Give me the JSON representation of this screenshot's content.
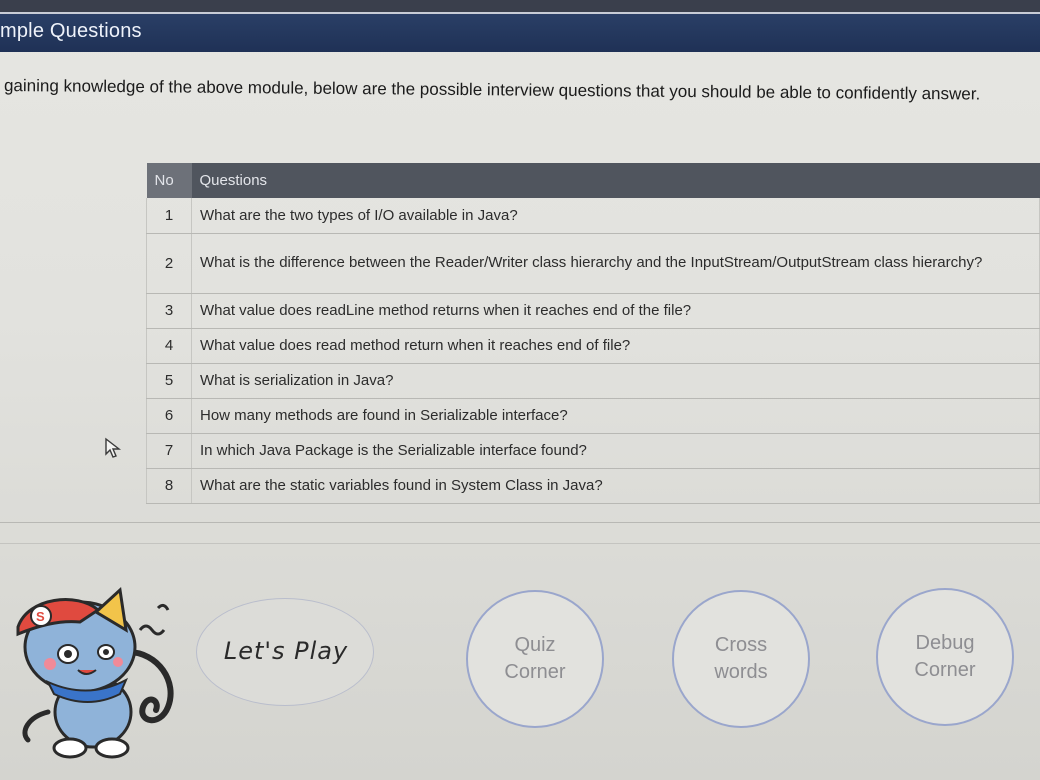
{
  "header": {
    "title": "mple Questions"
  },
  "intro": "gaining knowledge of the above module, below are the possible interview questions that you should be able to confidently answer.",
  "table": {
    "columns": [
      "No",
      "Questions"
    ],
    "rows": [
      {
        "no": "1",
        "question": "What are the two types of I/O available in Java?"
      },
      {
        "no": "2",
        "question": "What is the difference between the Reader/Writer class hierarchy and the InputStream/OutputStream class hierarchy?"
      },
      {
        "no": "3",
        "question": "What value does readLine method returns when it reaches end of the file?"
      },
      {
        "no": "4",
        "question": "What value does read method return when it reaches end of file?"
      },
      {
        "no": "5",
        "question": "What is serialization in Java?"
      },
      {
        "no": "6",
        "question": "How many methods are found in Serializable interface?"
      },
      {
        "no": "7",
        "question": "In which Java Package is the Serializable interface found?"
      },
      {
        "no": "8",
        "question": "What are the static variables found in System Class in Java?"
      }
    ]
  },
  "play": {
    "speech_label": "Let's Play",
    "buttons": [
      {
        "line1": "Quiz",
        "line2": "Corner"
      },
      {
        "line1": "Cross",
        "line2": "words"
      },
      {
        "line1": "Debug",
        "line2": "Corner"
      }
    ]
  },
  "mascot": {
    "cap_letter": "S"
  },
  "colors": {
    "header": "#1f3156",
    "table_header": "#50555e",
    "circle_border": "#9aa6cc"
  },
  "icons": [
    "mouse-cursor-icon",
    "mascot-cat-icon"
  ]
}
